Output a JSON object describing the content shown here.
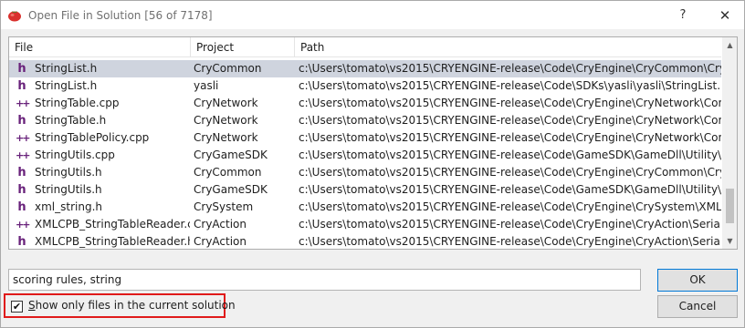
{
  "window": {
    "title": "Open File in Solution [56 of 7178]",
    "help_label": "?",
    "close_label": "✕"
  },
  "columns": {
    "file": "File",
    "project": "Project",
    "path": "Path"
  },
  "rows": [
    {
      "icon": "h",
      "file": "StringList.h",
      "project": "CryCommon",
      "path": "c:\\Users\\tomato\\vs2015\\CRYENGINE-release\\Code\\CryEngine\\CryCommon\\CrySerializa",
      "selected": true
    },
    {
      "icon": "h",
      "file": "StringList.h",
      "project": "yasli",
      "path": "c:\\Users\\tomato\\vs2015\\CRYENGINE-release\\Code\\SDKs\\yasli\\yasli\\StringList.h",
      "selected": false
    },
    {
      "icon": "cpp",
      "file": "StringTable.cpp",
      "project": "CryNetwork",
      "path": "c:\\Users\\tomato\\vs2015\\CRYENGINE-release\\Code\\CryEngine\\CryNetwork\\Compressio",
      "selected": false
    },
    {
      "icon": "h",
      "file": "StringTable.h",
      "project": "CryNetwork",
      "path": "c:\\Users\\tomato\\vs2015\\CRYENGINE-release\\Code\\CryEngine\\CryNetwork\\Compressio",
      "selected": false
    },
    {
      "icon": "cpp",
      "file": "StringTablePolicy.cpp",
      "project": "CryNetwork",
      "path": "c:\\Users\\tomato\\vs2015\\CRYENGINE-release\\Code\\CryEngine\\CryNetwork\\Compressio",
      "selected": false
    },
    {
      "icon": "cpp",
      "file": "StringUtils.cpp",
      "project": "CryGameSDK",
      "path": "c:\\Users\\tomato\\vs2015\\CRYENGINE-release\\Code\\GameSDK\\GameDll\\Utility\\StringUtils",
      "selected": false
    },
    {
      "icon": "h",
      "file": "StringUtils.h",
      "project": "CryCommon",
      "path": "c:\\Users\\tomato\\vs2015\\CRYENGINE-release\\Code\\CryEngine\\CryCommon\\CryString\\S",
      "selected": false
    },
    {
      "icon": "h",
      "file": "StringUtils.h",
      "project": "CryGameSDK",
      "path": "c:\\Users\\tomato\\vs2015\\CRYENGINE-release\\Code\\GameSDK\\GameDll\\Utility\\StringUtils",
      "selected": false
    },
    {
      "icon": "h",
      "file": "xml_string.h",
      "project": "CrySystem",
      "path": "c:\\Users\\tomato\\vs2015\\CRYENGINE-release\\Code\\CryEngine\\CrySystem\\XML\\xml_stri",
      "selected": false
    },
    {
      "icon": "cpp",
      "file": "XMLCPB_StringTableReader.c...",
      "project": "CryAction",
      "path": "c:\\Users\\tomato\\vs2015\\CRYENGINE-release\\Code\\CryEngine\\CryAction\\Serialization\\X",
      "selected": false
    },
    {
      "icon": "h",
      "file": "XMLCPB_StringTableReader.h",
      "project": "CryAction",
      "path": "c:\\Users\\tomato\\vs2015\\CRYENGINE-release\\Code\\CryEngine\\CryAction\\Serialization\\X",
      "selected": false
    }
  ],
  "search": {
    "value": "scoring rules, string"
  },
  "buttons": {
    "ok": "OK",
    "cancel": "Cancel"
  },
  "checkbox": {
    "label_underlined": "S",
    "label_rest": "how only files in the current solution",
    "checked": true,
    "mark": "✔"
  },
  "scrollbar": {
    "up": "▲",
    "down": "▼"
  },
  "colors": {
    "selected_row": "#cfd4de",
    "highlight_border": "#e01a1a",
    "file_icon": "#68217a"
  }
}
